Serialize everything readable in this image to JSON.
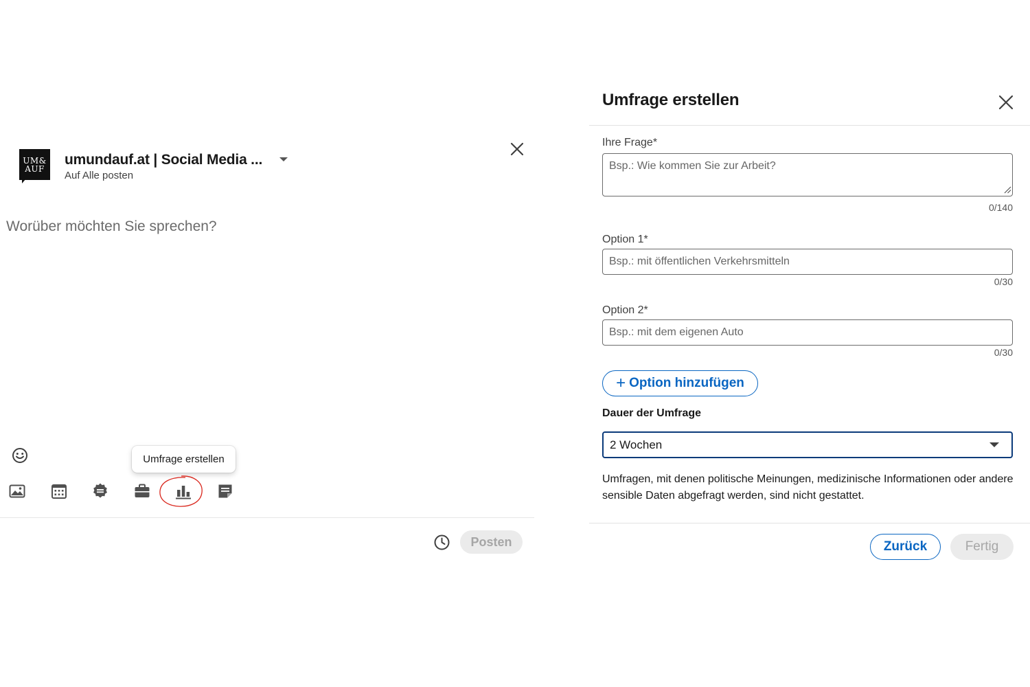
{
  "composer": {
    "author_name": "umundauf.at | Social Media ...",
    "author_scope": "Auf Alle posten",
    "logo_lines": [
      "UM&",
      "AUF"
    ],
    "post_placeholder": "Worüber möchten Sie sprechen?",
    "tooltip": "Umfrage erstellen",
    "toolbar_icons": [
      "image-icon",
      "calendar-icon",
      "badge-icon",
      "briefcase-icon",
      "poll-chart-icon",
      "document-icon"
    ],
    "highlight_color": "#d9261c",
    "post_button": "Posten"
  },
  "poll": {
    "title": "Umfrage erstellen",
    "question_label": "Ihre Frage*",
    "question_placeholder": "Bsp.: Wie kommen Sie zur Arbeit?",
    "question_counter": "0/140",
    "options": [
      {
        "label": "Option 1*",
        "placeholder": "Bsp.: mit öffentlichen Verkehrsmitteln",
        "counter": "0/30"
      },
      {
        "label": "Option 2*",
        "placeholder": "Bsp.: mit dem eigenen Auto",
        "counter": "0/30"
      }
    ],
    "add_option_label": "Option hinzufügen",
    "duration_label": "Dauer der Umfrage",
    "duration_value": "2 Wochen",
    "disclaimer": "Umfragen, mit denen politische Meinungen, medizinische Informationen oder andere sensible Daten abgefragt werden, sind nicht gestattet.",
    "back_button": "Zurück",
    "done_button": "Fertig"
  },
  "colors": {
    "accent": "#0a66c2",
    "select_border": "#0a3a7a",
    "disabled_bg": "#ebebeb",
    "disabled_text": "#a6a6a6"
  }
}
